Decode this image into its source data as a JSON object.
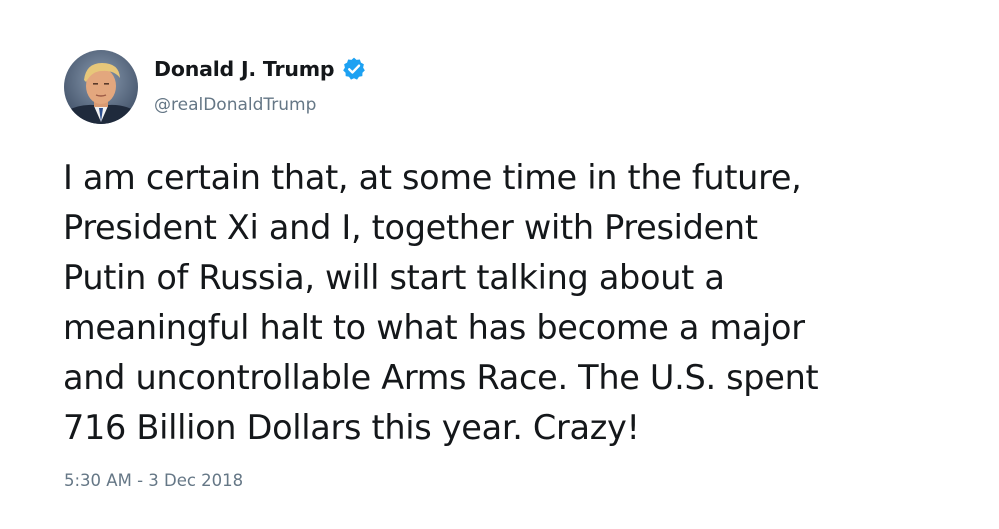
{
  "author": {
    "name": "Donald J. Trump",
    "handle": "@realDonaldTrump",
    "verified": true,
    "verified_icon": "verified-badge-icon",
    "verified_color": "#1da1f2"
  },
  "tweet": {
    "lines": [
      "I am certain that, at some time in the future,",
      "President Xi and I, together with President",
      "Putin of Russia, will start talking about a",
      "meaningful halt to what has become a major",
      "and uncontrollable Arms Race. The U.S. spent",
      "716 Billion Dollars this year. Crazy!"
    ],
    "timestamp": "5:30 AM - 3 Dec 2018"
  },
  "colors": {
    "text_primary": "#14171a",
    "text_secondary": "#657786",
    "background": "#ffffff"
  }
}
